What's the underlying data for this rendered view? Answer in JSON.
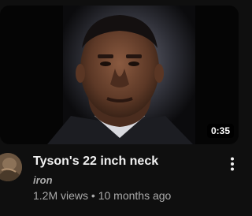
{
  "video": {
    "duration": "0:35",
    "title": "Tyson's 22 inch neck",
    "channel": "iron",
    "views": "1.2M views",
    "separator": "•",
    "age": "10 months ago"
  },
  "icons": {
    "thumbnail": "portrait-thumbnail",
    "avatar": "channel-avatar",
    "more": "vertical-dots-icon"
  },
  "colors": {
    "background": "#0f0f0f",
    "title": "#f1f1f1",
    "secondary": "#aaaaaa"
  }
}
